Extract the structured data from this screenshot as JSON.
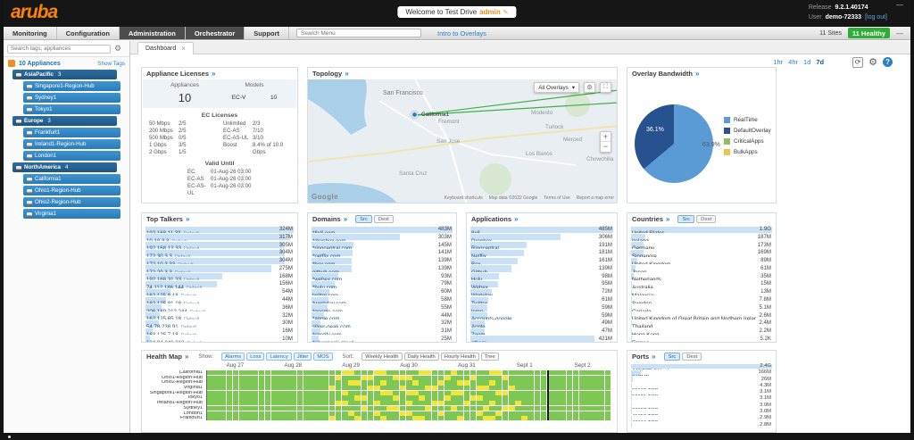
{
  "icons": {
    "gear": "⚙",
    "help": "?",
    "refresh": "⟳",
    "close": "×",
    "minimize": "—",
    "edit": "✎",
    "expand": "⛶",
    "arrow_down": "▾",
    "more": "»",
    "zoom_in": "+",
    "zoom_out": "−"
  },
  "topbar": {
    "logo": "aruba",
    "welcome_text": "Welcome to Test Drive",
    "welcome_user": "admin",
    "release_label": "Release",
    "release_value": "9.2.1.40174",
    "user_label": "User",
    "user_value": "demo-72333",
    "logout_label": "[log out]"
  },
  "menubar": {
    "items": [
      {
        "label": "Monitoring",
        "dark": false
      },
      {
        "label": "Configuration",
        "dark": false
      },
      {
        "label": "Administration",
        "dark": true
      },
      {
        "label": "Orchestrator",
        "dark": true
      },
      {
        "label": "Support",
        "dark": false
      }
    ],
    "search_placeholder": "Search Menu",
    "intro_link": "Intro to Overlays",
    "sites_label": "11 Sites",
    "health_badge": "11 Healthy"
  },
  "sidebar": {
    "search_placeholder": "Search tags, appliances",
    "appliances_label": "10 Appliances",
    "show_tags_label": "Show Tags",
    "groups": [
      {
        "label": "AsiaPacific",
        "count": "3",
        "items": [
          "Singapore1-Region-Hub",
          "Sydney1",
          "Tokyo1"
        ]
      },
      {
        "label": "Europe",
        "count": "3",
        "items": [
          "Frankfurt1",
          "Ireland1-Region-Hub",
          "London1"
        ]
      },
      {
        "label": "NorthAmerica",
        "count": "4",
        "items": [
          "California1",
          "Ohio1-Region-Hub",
          "Ohio2-Region-Hub",
          "Virginia1"
        ]
      }
    ]
  },
  "dashboard": {
    "tab_label": "Dashboard",
    "time_ranges": [
      "1hr",
      "4hr",
      "1d",
      "7d"
    ],
    "active_range": "7d"
  },
  "licenses": {
    "title": "Appliance Licenses",
    "appliances_label": "Appliances",
    "models_label": "Models",
    "appliances_value": "10",
    "model_name": "EC-V",
    "model_value": "10",
    "ec_title": "EC Licenses",
    "left_rows": [
      {
        "label": "50 Mbps",
        "value": "2/5"
      },
      {
        "label": "200 Mbps",
        "value": "2/5"
      },
      {
        "label": "500 Mbps",
        "value": "0/5"
      },
      {
        "label": "1 Gbps",
        "value": "3/5"
      },
      {
        "label": "2 Gbps",
        "value": "1/5"
      }
    ],
    "right_rows": [
      {
        "label": "Unlimited",
        "value": "2/3"
      },
      {
        "label": "EC-AS",
        "value": "7/10"
      },
      {
        "label": "EC-AS-UL",
        "value": "3/10"
      },
      {
        "label": "Boost",
        "value": "8.4% of 10.0 Gbps"
      }
    ],
    "valid_title": "Valid Until",
    "valid_rows": [
      {
        "label": "EC",
        "value": "01-Aug-26 03:00"
      },
      {
        "label": "EC-AS",
        "value": "01-Aug-26 03:00"
      },
      {
        "label": "EC-AS-UL",
        "value": "01-Aug-26 03:00"
      }
    ]
  },
  "topology": {
    "title": "Topology",
    "overlay_select": "All Overlays",
    "marker_label": "California1",
    "map_labels": [
      "San Francisco",
      "Fremont",
      "San Jose",
      "Modesto",
      "Turlock",
      "Merced",
      "Los Banos",
      "Santa Cruz",
      "Chowchilla"
    ],
    "google_logo": "Google",
    "attribution": [
      "Keyboard shortcuts",
      "Map data ©2022 Google",
      "Terms of Use",
      "Report a map error"
    ]
  },
  "overlay_bandwidth": {
    "title": "Overlay Bandwidth",
    "slices": [
      {
        "name": "RealTime",
        "pct": 63.9,
        "color": "#5b9bd5"
      },
      {
        "name": "DefaultOverlay",
        "pct": 36.1,
        "color": "#27518f"
      },
      {
        "name": "CriticalApps",
        "pct": 0,
        "color": "#8fbc6f"
      },
      {
        "name": "BulkApps",
        "pct": 0,
        "color": "#f0c24b"
      }
    ],
    "label_small": "36.1%",
    "label_large": "63.9%"
  },
  "top_talkers": {
    "title": "Top Talkers",
    "items": [
      {
        "label": "192.168.11.33",
        "tag": "Default",
        "value": "324M"
      },
      {
        "label": "10.10.3.3",
        "tag": "Default",
        "value": "317M"
      },
      {
        "label": "192.168.12.33",
        "tag": "Default",
        "value": "305M"
      },
      {
        "label": "172.30.3.3",
        "tag": "Default",
        "value": "304M"
      },
      {
        "label": "172.10.3.33",
        "tag": "Default",
        "value": "304M"
      },
      {
        "label": "172.20.3.3",
        "tag": "Default",
        "value": "275M"
      },
      {
        "label": "192.168.31.33",
        "tag": "Default",
        "value": "168M"
      },
      {
        "label": "74.112.186.144",
        "tag": "Default",
        "value": "156M"
      },
      {
        "label": "162.125.8.18",
        "tag": "Default",
        "value": "54M"
      },
      {
        "label": "162.125.81.18",
        "tag": "Default",
        "value": "44M"
      },
      {
        "label": "206.189.212.244",
        "tag": "Default",
        "value": "36M"
      },
      {
        "label": "162.125.65.18",
        "tag": "Default",
        "value": "32M"
      },
      {
        "label": "54.78.238.91",
        "tag": "Default",
        "value": "30M"
      },
      {
        "label": "163.125.7.18",
        "tag": "Default",
        "value": "16M"
      },
      {
        "label": "104.94.246.212",
        "tag": "Default",
        "value": "10M"
      }
    ]
  },
  "domains": {
    "title": "Domains",
    "toggle": [
      "Src",
      "Dest"
    ],
    "active_toggle": "Src",
    "items": [
      {
        "label": "*8x8.com",
        "value": "483M"
      },
      {
        "label": "*dropbox.com",
        "value": "303M"
      },
      {
        "label": "*ringcentral.com",
        "value": "145M"
      },
      {
        "label": "*netflix.com",
        "value": "141M"
      },
      {
        "label": "*box.com",
        "value": "139M"
      },
      {
        "label": "github.com",
        "value": "139M"
      },
      {
        "label": "*webex.com",
        "value": "93M"
      },
      {
        "label": "*hulu.com",
        "value": "79M"
      },
      {
        "label": "twitter.com",
        "value": "60M"
      },
      {
        "label": "*workday.com",
        "value": "58M"
      },
      {
        "label": "*google.com",
        "value": "55M"
      },
      {
        "label": "*apple.com",
        "value": "44M"
      },
      {
        "label": "silver-peak.com",
        "value": "32M"
      },
      {
        "label": "*spotify.com",
        "value": "31M"
      },
      {
        "label": "*silverpeak.cloud",
        "value": "25M"
      }
    ]
  },
  "applications": {
    "title": "Applications",
    "items": [
      {
        "label": "8x8",
        "value": "485M"
      },
      {
        "label": "Dropbox",
        "value": "306M"
      },
      {
        "label": "Ringcentral",
        "value": "191M"
      },
      {
        "label": "Netflix",
        "value": "181M"
      },
      {
        "label": "Box",
        "value": "161M"
      },
      {
        "label": "Github",
        "value": "139M"
      },
      {
        "label": "Hulu",
        "value": "98M"
      },
      {
        "label": "Webex",
        "value": "95M"
      },
      {
        "label": "Workday",
        "value": "72M"
      },
      {
        "label": "Twitter",
        "value": "61M"
      },
      {
        "label": "Icmp",
        "value": "59M"
      },
      {
        "label": "Accounts-google",
        "value": "59M"
      },
      {
        "label": "Apple",
        "value": "49M"
      },
      {
        "label": "Zoom",
        "value": "47M"
      },
      {
        "label": "others",
        "value": "421M"
      }
    ]
  },
  "countries": {
    "title": "Countries",
    "toggle": [
      "Src",
      "Dest"
    ],
    "active_toggle": "Src",
    "items": [
      {
        "label": "United States",
        "value": "1.9G"
      },
      {
        "label": "Ireland",
        "value": "187M"
      },
      {
        "label": "Germany",
        "value": "173M"
      },
      {
        "label": "Singapore",
        "value": "169M"
      },
      {
        "label": "United Kingdom",
        "value": "89M"
      },
      {
        "label": "Japan",
        "value": "61M"
      },
      {
        "label": "Netherlands",
        "value": "35M"
      },
      {
        "label": "Australia",
        "value": "15M"
      },
      {
        "label": "Malaysia",
        "value": "13M"
      },
      {
        "label": "Sweden",
        "value": "7.8M"
      },
      {
        "label": "Canada",
        "value": "5.1M"
      },
      {
        "label": "United Kingdom of Great Britain and Northern Irelan",
        "value": "2.6M"
      },
      {
        "label": "Thailand",
        "value": "2.4M"
      },
      {
        "label": "Hong Kong",
        "value": "2.2M"
      },
      {
        "label": "France",
        "value": "5.2K"
      }
    ]
  },
  "health_map": {
    "title": "Health Map",
    "show_label": "Show:",
    "show_buttons": [
      "Alarms",
      "Loss",
      "Latency",
      "Jitter",
      "MOS"
    ],
    "sort_label": "Sort:",
    "sort_buttons": [
      "Weekly Health",
      "Daily Health",
      "Hourly Health",
      "Tree"
    ],
    "dates": [
      "Aug 27",
      "Aug 28",
      "Aug 29",
      "Aug 30",
      "Aug 31",
      "Sept 1",
      "Sept 2"
    ],
    "cols": 63,
    "marker_col": 53,
    "colors": {
      "good": "#7dc855",
      "warn": "#f2e53a"
    },
    "rows": [
      {
        "name": "California1",
        "yellow": [
          21,
          22,
          26,
          27,
          33,
          34,
          38,
          44,
          45
        ]
      },
      {
        "name": "Ohio1-Region-Hub",
        "yellow": [
          20,
          24,
          25,
          29,
          30,
          31,
          37,
          41,
          46
        ]
      },
      {
        "name": "Ohio2-Region-Hub",
        "yellow": [
          22,
          23,
          27,
          32,
          36,
          39,
          40,
          44
        ]
      },
      {
        "name": "Virginia1",
        "yellow": [
          19,
          25,
          26,
          30,
          34,
          35,
          42,
          43,
          47
        ]
      },
      {
        "name": "Singapore1-Region-Hub",
        "yellow": [
          21,
          27,
          28,
          31,
          32,
          38,
          39,
          45,
          46
        ]
      },
      {
        "name": "Tokyo1",
        "yellow": [
          23,
          24,
          29,
          33,
          37,
          41,
          42
        ]
      },
      {
        "name": "Ireland1-Region-Hub",
        "yellow": [
          20,
          21,
          26,
          31,
          35,
          36,
          40,
          44,
          48
        ]
      },
      {
        "name": "Sydney1",
        "yellow": [
          24,
          28,
          29,
          34,
          38,
          43,
          46,
          47
        ]
      },
      {
        "name": "London1",
        "yellow": [
          22,
          26,
          30,
          31,
          36,
          42,
          45
        ]
      },
      {
        "name": "Frankfurt1",
        "yellow": [
          19,
          23,
          27,
          32,
          33,
          39,
          43,
          44,
          49
        ]
      }
    ]
  },
  "ports": {
    "title": "Ports",
    "toggle": [
      "Src",
      "Dest"
    ],
    "active_toggle": "Src",
    "items": [
      {
        "label": "443 TCP (Https)",
        "value": "2.4G"
      },
      {
        "label": "0 ICMP",
        "value": "166M"
      },
      {
        "label": "80 TCP (Http)",
        "value": "26M"
      },
      {
        "label": "52662 TCP",
        "value": "4.3M"
      },
      {
        "label": "52661 TCP",
        "value": "3.1M"
      },
      {
        "label": "46835 TCP",
        "value": "3.1M"
      },
      {
        "label": "37037 TCP",
        "value": "3.0M"
      },
      {
        "label": "41353 TCP",
        "value": "3.0M"
      },
      {
        "label": "40916 TCP",
        "value": "2.9M"
      },
      {
        "label": "42562 TCP",
        "value": "2.8M"
      }
    ]
  }
}
